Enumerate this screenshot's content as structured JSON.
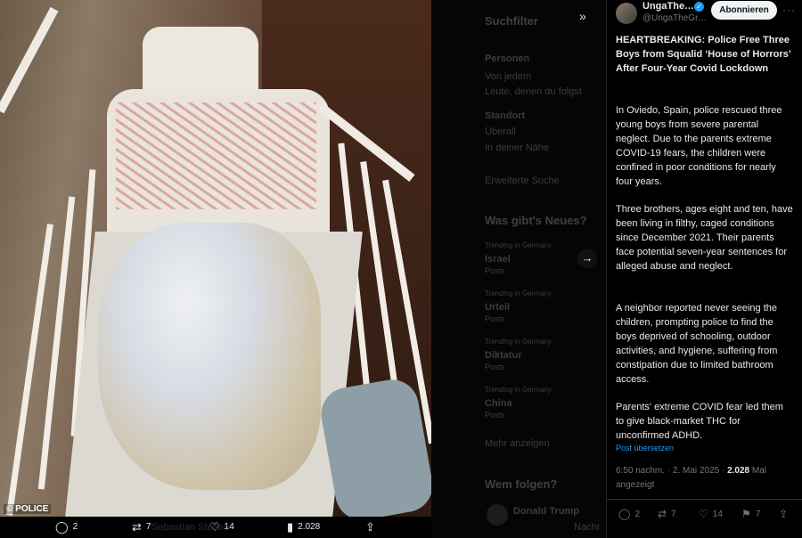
{
  "photo": {
    "watermark": "© POLICE",
    "actions": {
      "replies": "2",
      "reposts": "7",
      "likes": "14",
      "views": "2.028"
    }
  },
  "background_page": {
    "search_filter_title": "Suchfilter",
    "people_label": "Personen",
    "people_opt1": "Von jedem",
    "people_opt2": "Leute, denen du folgst",
    "location_label": "Standort",
    "location_opt1": "Überall",
    "location_opt2": "In deiner Nähe",
    "advanced_search": "Erweiterte Suche",
    "whats_new_title": "Was gibt's Neues?",
    "trends": [
      {
        "category": "Trending in Germany",
        "title": "Israel",
        "count": "Posts"
      },
      {
        "category": "Trending in Germany",
        "title": "Urteil",
        "count": "Posts"
      },
      {
        "category": "Trending in Germany",
        "title": "Diktatur",
        "count": "Posts"
      },
      {
        "category": "Trending in Germany",
        "title": "China",
        "count": "Posts"
      }
    ],
    "show_more": "Mehr anzeigen",
    "who_to_follow_title": "Wem folgen?",
    "suggestion_name": "Donald Trump",
    "partial_name": "Sebastian Steffen",
    "partial_nachr": "Nachr"
  },
  "post": {
    "display_name": "UngaThe…",
    "handle": "@UngaTheGr…",
    "follow_label": "Abonnieren",
    "headline": "HEARTBREAKING: Police Free Three Boys from Squalid ‘House of Horrors’ After Four-Year Covid Lockdown",
    "paragraphs": [
      "In Oviedo, Spain, police rescued three young boys from severe parental neglect. Due to the parents extreme COVID-19 fears, the children were confined in poor conditions for nearly four years.",
      "Three brothers, ages eight and ten, have been living in filthy, caged conditions since December 2021. Their parents face potential seven-year sentences for alleged abuse and neglect.",
      "A neighbor reported never seeing the children, prompting police to find the boys deprived of schooling, outdoor activities, and hygiene, suffering from constipation due to limited bathroom access.",
      "Parents' extreme COVID fear led them to give black-market THC for unconfirmed ADHD."
    ],
    "translate_label": "Post übersetzen",
    "timestamp": "6:50 nachm. · 2. Mai 2025 ·",
    "views_count": "2.028",
    "views_label": "Mal angezeigt",
    "actions": {
      "replies": "2",
      "reposts": "7",
      "likes": "14",
      "bookmarks": "7"
    }
  }
}
